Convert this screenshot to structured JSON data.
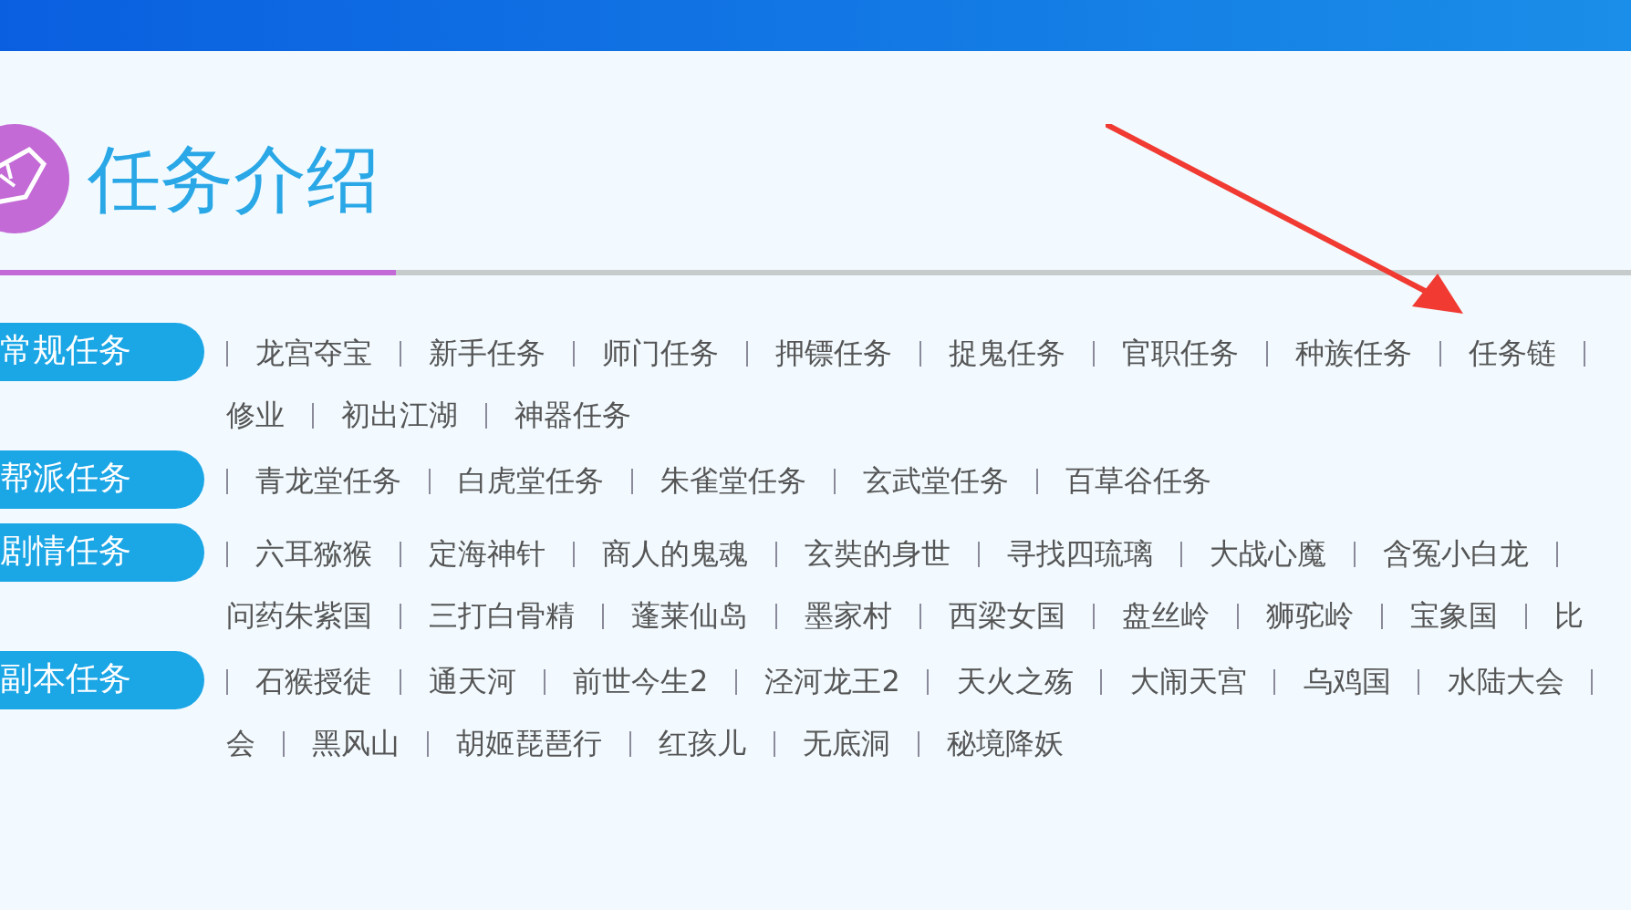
{
  "section": {
    "title": "任务介绍"
  },
  "categories": [
    {
      "label": "常规任务",
      "lines": [
        {
          "lead": true,
          "trail": true,
          "items": [
            "龙宫夺宝",
            "新手任务",
            "师门任务",
            "押镖任务",
            "捉鬼任务",
            "官职任务",
            "种族任务",
            "任务链"
          ]
        },
        {
          "lead": false,
          "trail": false,
          "items": [
            "修业",
            "初出江湖",
            "神器任务"
          ]
        }
      ]
    },
    {
      "label": "帮派任务",
      "lines": [
        {
          "lead": true,
          "trail": false,
          "items": [
            "青龙堂任务",
            "白虎堂任务",
            "朱雀堂任务",
            "玄武堂任务",
            "百草谷任务"
          ]
        }
      ]
    },
    {
      "label": "剧情任务",
      "lines": [
        {
          "lead": true,
          "trail": true,
          "items": [
            "六耳猕猴",
            "定海神针",
            "商人的鬼魂",
            "玄奘的身世",
            "寻找四琉璃",
            "大战心魔",
            "含冤小白龙"
          ]
        },
        {
          "lead": false,
          "trail": false,
          "items": [
            "问药朱紫国",
            "三打白骨精",
            "蓬莱仙岛",
            "墨家村",
            "西梁女国",
            "盘丝岭",
            "狮驼岭",
            "宝象国",
            "比"
          ]
        }
      ]
    },
    {
      "label": "副本任务",
      "lines": [
        {
          "lead": true,
          "trail": true,
          "items": [
            "石猴授徒",
            "通天河",
            "前世今生2",
            "泾河龙王2",
            "天火之殇",
            "大闹天宫",
            "乌鸡国",
            "水陆大会"
          ]
        },
        {
          "lead": false,
          "trail": false,
          "items": [
            "会",
            "黑风山",
            "胡姬琵琶行",
            "红孩儿",
            "无底洞",
            "秘境降妖"
          ]
        }
      ]
    }
  ]
}
